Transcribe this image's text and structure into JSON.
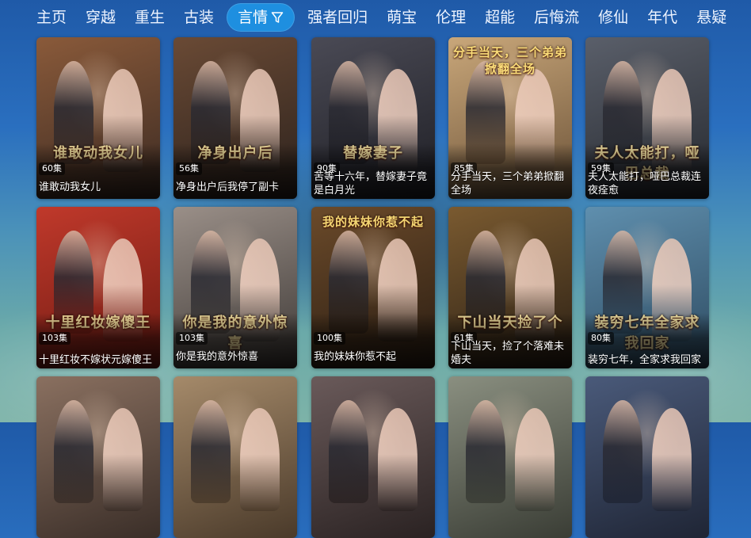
{
  "tabs": [
    {
      "label": "主页"
    },
    {
      "label": "穿越"
    },
    {
      "label": "重生"
    },
    {
      "label": "古装"
    },
    {
      "label": "言情",
      "active": true,
      "icon": "filter-funnel-icon"
    },
    {
      "label": "强者回归"
    },
    {
      "label": "萌宝"
    },
    {
      "label": "伦理"
    },
    {
      "label": "超能"
    },
    {
      "label": "后悔流"
    },
    {
      "label": "修仙"
    },
    {
      "label": "年代"
    },
    {
      "label": "悬疑"
    }
  ],
  "cards": [
    {
      "title": "谁敢动我女儿",
      "episodes": "60集",
      "poster_text": "谁敢动我女儿",
      "colors": [
        "#8a5a3a",
        "#3b2a22"
      ]
    },
    {
      "title": "净身出户后我停了副卡",
      "episodes": "56集",
      "poster_text": "净身出户后",
      "colors": [
        "#6a4a35",
        "#2b211c"
      ]
    },
    {
      "title": "苦等十六年，替嫁妻子竟是白月光",
      "episodes": "90集",
      "poster_text": "替嫁妻子",
      "colors": [
        "#4a4a55",
        "#1e1e24"
      ]
    },
    {
      "title": "分手当天，三个弟弟掀翻全场",
      "episodes": "85集",
      "poster_text": "分手当天，三个弟弟掀翻全场",
      "colors": [
        "#c9a77a",
        "#6b5238"
      ]
    },
    {
      "title": "夫人太能打，哑巴总裁连夜痊愈",
      "episodes": "59集",
      "poster_text": "夫人太能打，哑巴总裁",
      "colors": [
        "#5a5f6a",
        "#25282e"
      ]
    },
    {
      "title": "十里红妆不嫁状元嫁傻王",
      "episodes": "103集",
      "poster_text": "十里红妆嫁傻王",
      "colors": [
        "#c0392b",
        "#6e1a12"
      ]
    },
    {
      "title": "你是我的意外惊喜",
      "episodes": "103集",
      "poster_text": "你是我的意外惊喜",
      "colors": [
        "#9a8f88",
        "#3e3936"
      ]
    },
    {
      "title": "我的妹妹你惹不起",
      "episodes": "100集",
      "poster_text": "我的妹妹你惹不起",
      "colors": [
        "#6b4a2a",
        "#2a1d12"
      ]
    },
    {
      "title": "下山当天，捡了个落难未婚夫",
      "episodes": "61集",
      "poster_text": "下山当天捡了个",
      "colors": [
        "#7a5a30",
        "#2a1f14"
      ]
    },
    {
      "title": "装穷七年，全家求我回家",
      "episodes": "80集",
      "poster_text": "装穷七年全家求我回家",
      "colors": [
        "#5f8fae",
        "#2d4a60"
      ]
    },
    {
      "title": "",
      "episodes": "",
      "poster_text": "",
      "colors": [
        "#8a7060",
        "#3a2e28"
      ]
    },
    {
      "title": "",
      "episodes": "",
      "poster_text": "",
      "colors": [
        "#a58a6a",
        "#4a3a2a"
      ]
    },
    {
      "title": "",
      "episodes": "",
      "poster_text": "",
      "colors": [
        "#6a5a5a",
        "#2a2222"
      ]
    },
    {
      "title": "",
      "episodes": "",
      "poster_text": "",
      "colors": [
        "#8a8f80",
        "#3a3d35"
      ]
    },
    {
      "title": "",
      "episodes": "",
      "poster_text": "",
      "colors": [
        "#4a5a7a",
        "#1f2535"
      ]
    }
  ]
}
